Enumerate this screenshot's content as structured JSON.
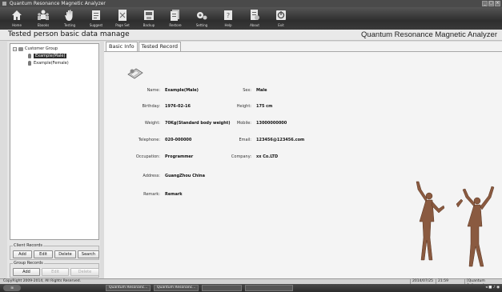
{
  "window": {
    "title": "Quantum Resonance Magnetic Analyzer"
  },
  "toolbar": {
    "buttons": [
      {
        "label": "Home",
        "icon": "home-icon"
      },
      {
        "label": "Ebooks",
        "icon": "user-group-icon"
      },
      {
        "label": "Testing",
        "icon": "hand-icon"
      },
      {
        "label": "Suggest",
        "icon": "document-icon"
      },
      {
        "label": "Page Set",
        "icon": "page-setup-icon"
      },
      {
        "label": "Backup",
        "icon": "backup-icon"
      },
      {
        "label": "Restore",
        "icon": "restore-icon"
      },
      {
        "label": "Setting",
        "icon": "gear-icon"
      },
      {
        "label": "Help",
        "icon": "help-icon"
      },
      {
        "label": "About",
        "icon": "about-icon"
      },
      {
        "label": "Exit",
        "icon": "exit-icon"
      }
    ]
  },
  "header": {
    "page_title": "Tested person basic data manage",
    "app_name": "Quantum Resonance Magnetic Analyzer"
  },
  "tree": {
    "root": "Customer Group",
    "children": [
      "Example(Male)",
      "Example(Female)"
    ]
  },
  "client_records": {
    "title": "Client Records",
    "buttons": [
      "Add",
      "Edit",
      "Delete",
      "Search"
    ]
  },
  "group_records": {
    "title": "Group Records",
    "buttons": [
      "Add",
      "Edit",
      "Delete"
    ]
  },
  "tabs": [
    "Basic Info",
    "Tested Record"
  ],
  "basic_info": {
    "name": {
      "label": "Name:",
      "value": "Example(Male)"
    },
    "sex": {
      "label": "Sex:",
      "value": "Male"
    },
    "birthday": {
      "label": "Birthday:",
      "value": "1976-02-16"
    },
    "height": {
      "label": "Height:",
      "value": "175 cm"
    },
    "weight": {
      "label": "Weight:",
      "value": "70Kg(Standard body weight)"
    },
    "mobile": {
      "label": "Mobile:",
      "value": "13000000000"
    },
    "telephone": {
      "label": "Telephone:",
      "value": "020-000000"
    },
    "email": {
      "label": "Email:",
      "value": "123456@123456.com"
    },
    "occupation": {
      "label": "Occupation:",
      "value": "Programmer"
    },
    "company": {
      "label": "Company:",
      "value": "xx Co.LTD"
    },
    "address": {
      "label": "Address:",
      "value": "GuangZhou China"
    },
    "remark": {
      "label": "Remark:",
      "value": "Remark"
    }
  },
  "statusbar": {
    "copyright": "CopyRight 2009-2014, All Rights Reserved.",
    "date": "2014/07/25",
    "time": "21:59",
    "company": "[Quantum Software]"
  },
  "taskbar": {
    "items": [
      "Quantum Resonanc...",
      "Quantum Resonanc..."
    ]
  }
}
